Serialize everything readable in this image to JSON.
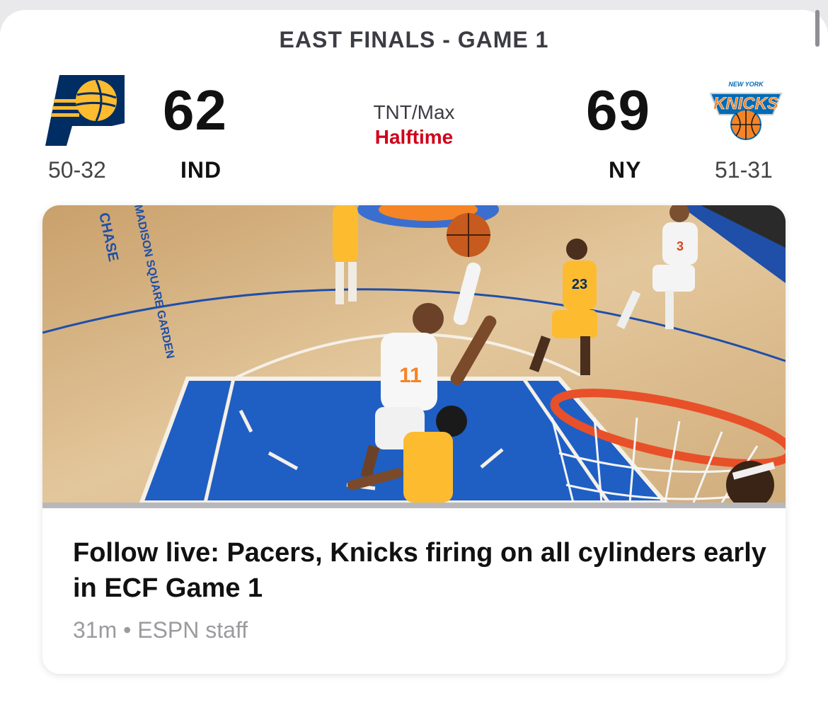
{
  "game": {
    "title": "EAST FINALS - GAME 1",
    "broadcast": "TNT/Max",
    "status": "Halftime"
  },
  "away_team": {
    "abbr": "IND",
    "score": "62",
    "record": "50-32",
    "logo_icon": "pacers-logo-icon",
    "color": "#002d62",
    "accent": "#fdbb30"
  },
  "home_team": {
    "abbr": "NY",
    "score": "69",
    "record": "51-31",
    "logo_icon": "knicks-logo-icon",
    "color": "#006bb6",
    "accent": "#f58426",
    "logo_text_top": "NEW YORK",
    "logo_text_main": "KNICKS"
  },
  "news": {
    "headline": "Follow live: Pacers, Knicks firing on all cylinders early in ECF Game 1",
    "meta": "31m • ESPN staff",
    "image_icon": "game-photo",
    "arena_text": "MADISON SQUARE GARDEN",
    "sponsor_text": "CHASE",
    "jersey_numbers": [
      "11",
      "23",
      "3"
    ]
  },
  "colors": {
    "status_red": "#d0021b",
    "court_wood": "#d9b98a",
    "paint_blue": "#1f5fc4",
    "rim_orange": "#e8502a"
  }
}
